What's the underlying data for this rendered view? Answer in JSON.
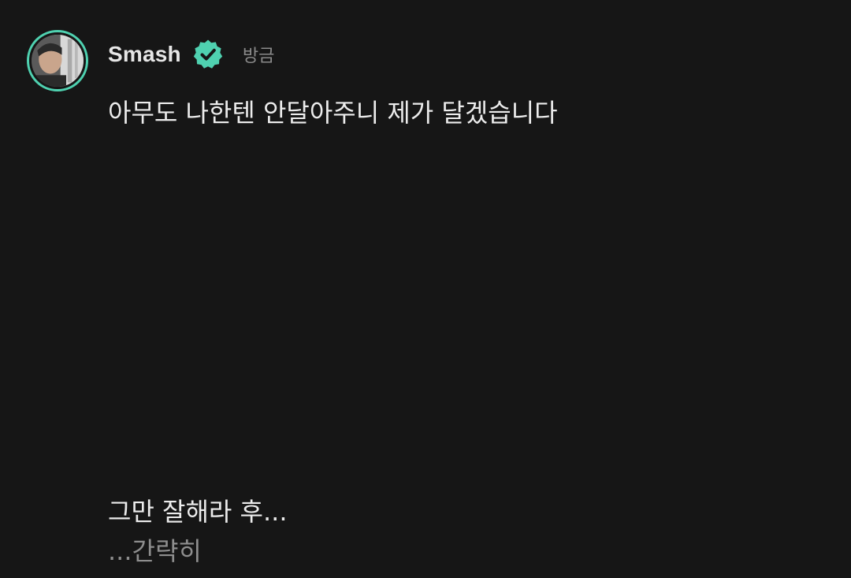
{
  "post": {
    "username": "Smash",
    "timestamp": "방금",
    "text": "아무도 나한텐 안달아주니 제가 달겠습니다",
    "reply_line1": "그만 잘해라 후...",
    "reply_line2": "...간략히"
  },
  "icons": {
    "verified": "verified-badge-icon"
  },
  "colors": {
    "background": "#161616",
    "accent": "#4fd1b0",
    "text": "#ececec",
    "muted": "#8a8a8a"
  }
}
